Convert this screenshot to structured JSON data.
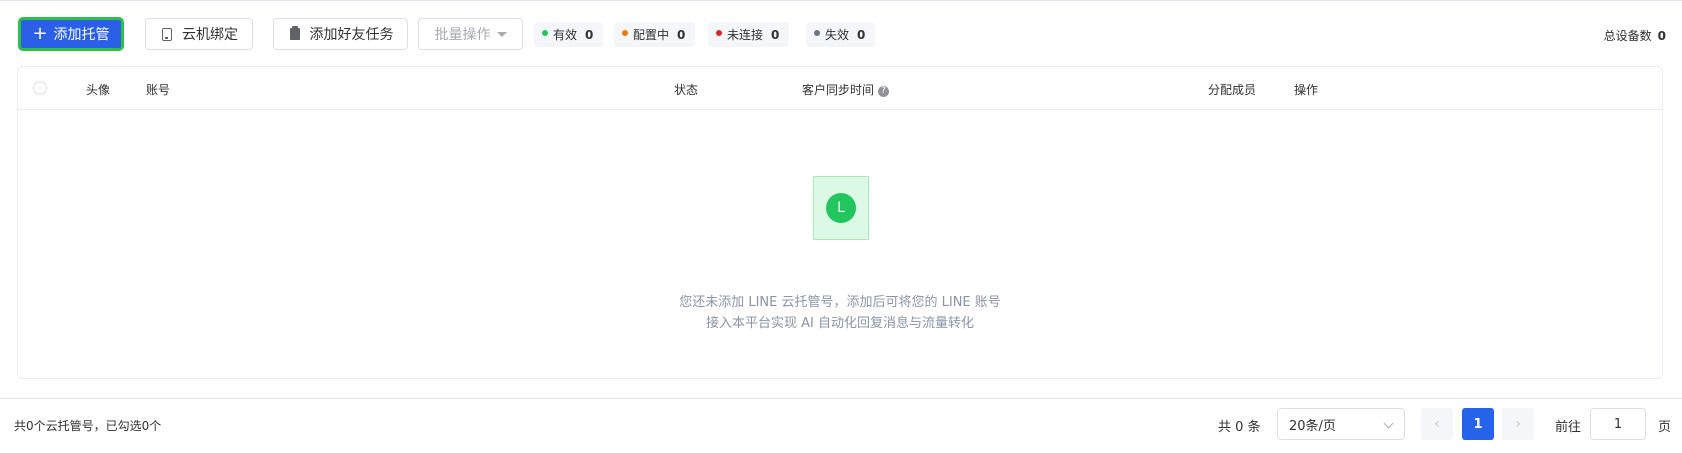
{
  "toolbar": {
    "add_hosting": "添加托管",
    "cloud_bind": "云机绑定",
    "add_friend_task": "添加好友任务",
    "bulk_actions": "批量操作"
  },
  "status_chips": {
    "valid": {
      "label": "有效",
      "count": "0",
      "color": "#22c55e"
    },
    "configuring": {
      "label": "配置中",
      "count": "0",
      "color": "#ea7a0c"
    },
    "unconnected": {
      "label": "未连接",
      "count": "0",
      "color": "#dc2626"
    },
    "invalid": {
      "label": "失效",
      "count": "0",
      "color": "#6b7280"
    }
  },
  "total_devices": {
    "label": "总设备数",
    "count": "0"
  },
  "table": {
    "columns": {
      "avatar": "头像",
      "account": "账号",
      "status": "状态",
      "sync_time": "客户同步时间",
      "members": "分配成员",
      "ops": "操作"
    },
    "empty": {
      "logo_letter": "L",
      "line1": "您还未添加 LINE 云托管号，添加后可将您的 LINE 账号",
      "line2": "接入本平台实现 AI 自动化回复消息与流量转化"
    }
  },
  "footer": {
    "selection_summary": "共0个云托管号，已勾选0个",
    "total": "共 0 条",
    "page_size": "20条/页",
    "current_page": "1",
    "goto_label": "前往",
    "goto_value": "1",
    "goto_suffix": "页"
  },
  "colors": {
    "primary": "#2b5fe8",
    "highlight_border": "#2fc04b"
  }
}
